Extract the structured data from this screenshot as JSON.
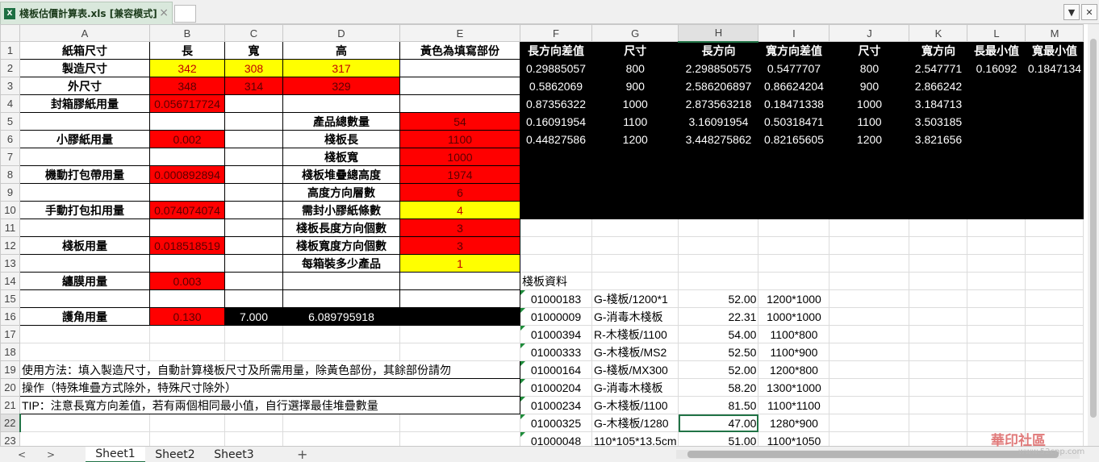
{
  "file_tab": {
    "title": "棧板估價計算表.xls [兼容模式]",
    "icon": "excel-file-icon",
    "close": "×"
  },
  "window_controls": {
    "dropdown": "▼",
    "close": "✕"
  },
  "columns": [
    "A",
    "B",
    "C",
    "D",
    "E",
    "F",
    "G",
    "H",
    "I",
    "J",
    "K",
    "L",
    "M"
  ],
  "rows": [
    "1",
    "2",
    "3",
    "4",
    "5",
    "6",
    "7",
    "8",
    "9",
    "10",
    "11",
    "12",
    "13",
    "14",
    "15",
    "16",
    "17",
    "18",
    "19",
    "20",
    "21",
    "22",
    "23"
  ],
  "cells": {
    "A1": "紙箱尺寸",
    "B1": "長",
    "C1": "寬",
    "D1": "高",
    "E1": "黃色為填寫部份",
    "F1": "長方向差值",
    "G1": "尺寸",
    "H1": "長方向",
    "I1": "寬方向差值",
    "J1": "尺寸",
    "K1": "寬方向",
    "L1": "長最小值",
    "M1": "寬最小值",
    "A2": "製造尺寸",
    "B2": "342",
    "C2": "308",
    "D2": "317",
    "F2": "0.29885057",
    "G2": "800",
    "H2": "2.298850575",
    "I2": "0.5477707",
    "J2": "800",
    "K2": "2.547771",
    "L2": "0.16092",
    "M2": "0.1847134",
    "A3": "外尺寸",
    "B3": "348",
    "C3": "314",
    "D3": "329",
    "F3": "0.5862069",
    "G3": "900",
    "H3": "2.586206897",
    "I3": "0.86624204",
    "J3": "900",
    "K3": "2.866242",
    "A4": "封箱膠紙用量",
    "B4": "0.056717724",
    "F4": "0.87356322",
    "G4": "1000",
    "H4": "2.873563218",
    "I4": "0.18471338",
    "J4": "1000",
    "K4": "3.184713",
    "D5": "產品總數量",
    "E5": "54",
    "F5": "0.16091954",
    "G5": "1100",
    "H5": "3.16091954",
    "I5": "0.50318471",
    "J5": "1100",
    "K5": "3.503185",
    "A6": "小膠紙用量",
    "B6": "0.002",
    "D6": "棧板長",
    "E6": "1100",
    "F6": "0.44827586",
    "G6": "1200",
    "H6": "3.448275862",
    "I6": "0.82165605",
    "J6": "1200",
    "K6": "3.821656",
    "D7": "棧板寬",
    "E7": "1000",
    "A8": "機動打包帶用量",
    "B8": "0.000892894",
    "D8": "棧板堆疊總高度",
    "E8": "1974",
    "D9": "高度方向層數",
    "E9": "6",
    "A10": "手動打包扣用量",
    "B10": "0.074074074",
    "D10": "需封小膠紙條數",
    "E10": "4",
    "D11": "棧板長度方向個數",
    "E11": "3",
    "A12": "棧板用量",
    "B12": "0.018518519",
    "D12": "棧板寬度方向個數",
    "E12": "3",
    "D13": "每箱裝多少產品",
    "E13": "1",
    "A14": "纏膜用量",
    "B14": "0.003",
    "F14": "棧板資料",
    "F15": "01000183",
    "G15": "G-棧板/1200*1",
    "H15": "52.00",
    "I15": "1200*1000",
    "A16": "護角用量",
    "B16": "0.130",
    "C16": "7.000",
    "D16": "6.089795918",
    "F16": "01000009",
    "G16": "G-消毒木棧板",
    "H16": "22.31",
    "I16": "1000*1000",
    "F17": "01000394",
    "G17": "R-木棧板/1100",
    "H17": "54.00",
    "I17": "1100*800",
    "F18": "01000333",
    "G18": "G-木棧板/MS2",
    "H18": "52.50",
    "I18": "1100*900",
    "A19": "使用方法：填入製造尺寸，自動計算棧板尺寸及所需用量，除黃色部份，其餘部份請勿",
    "F19": "01000164",
    "G19": "G-棧板/MX300",
    "H19": "52.00",
    "I19": "1200*800",
    "A20": "操作（特殊堆疊方式除外，特殊尺寸除外）",
    "F20": "01000204",
    "G20": "G-消毒木棧板",
    "H20": "58.20",
    "I20": "1300*1000",
    "A21": "TIP：注意長寬方向差值，若有兩個相同最小值，自行選擇最佳堆疊數量",
    "F21": "01000234",
    "G21": "G-木棧板/1100",
    "H21": "81.50",
    "I21": "1100*1100",
    "F22": "01000325",
    "G22": "G-木棧板/1280",
    "H22": "47.00",
    "I22": "1280*900",
    "F23": "01000048",
    "G23": "110*105*13.5cm",
    "H23": "51.00",
    "I23": "1100*1050"
  },
  "sheets": {
    "tabs": [
      "Sheet1",
      "Sheet2",
      "Sheet3"
    ],
    "active": "Sheet1",
    "add": "+",
    "prev": "<",
    "next": ">"
  },
  "watermark": {
    "text": "華印社區",
    "site": "www.52cnp.com"
  },
  "colors": {
    "header_fill": "#f3f3f3",
    "input_yellow": "#ffff00",
    "calc_red": "#ff0000",
    "black_block": "#000000",
    "accent": "#217346"
  }
}
